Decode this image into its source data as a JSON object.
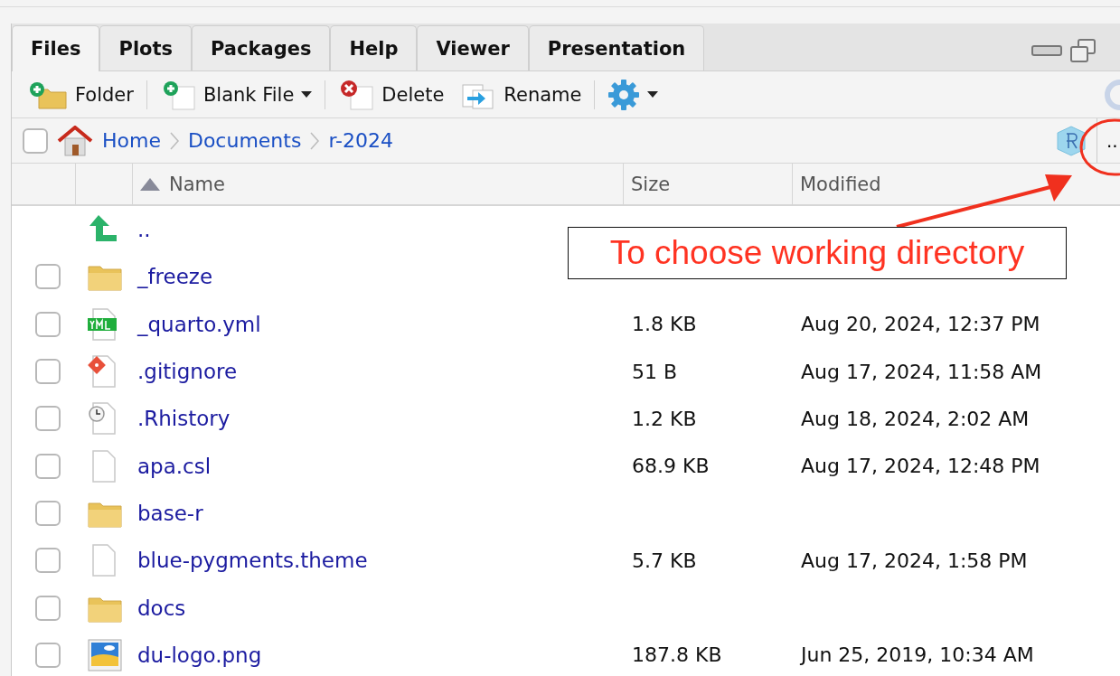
{
  "tabs": [
    {
      "label": "Files",
      "selected": true
    },
    {
      "label": "Plots",
      "selected": false
    },
    {
      "label": "Packages",
      "selected": false
    },
    {
      "label": "Help",
      "selected": false
    },
    {
      "label": "Viewer",
      "selected": false
    },
    {
      "label": "Presentation",
      "selected": false
    }
  ],
  "toolbar": [
    {
      "kind": "folder",
      "label": "Folder",
      "dropdown": false
    },
    {
      "kind": "file",
      "label": "Blank File",
      "dropdown": true
    },
    {
      "kind": "delete",
      "label": "Delete",
      "dropdown": false
    },
    {
      "kind": "rename",
      "label": "Rename",
      "dropdown": false
    },
    {
      "kind": "gear",
      "dropdown": true
    }
  ],
  "breadcrumb": {
    "select_all": {
      "checked": false
    },
    "path": [
      "Home",
      "Documents",
      "r-2024"
    ],
    "more_button": ".."
  },
  "columns": [
    {
      "label": "Name",
      "sorted": true
    },
    {
      "label": "Size",
      "sorted": false
    },
    {
      "label": "Modified",
      "sorted": false
    }
  ],
  "rows": [
    {
      "kind": "parent",
      "name": ".."
    },
    {
      "kind": "folder",
      "name": "_freeze",
      "checked": false
    },
    {
      "kind": "yml",
      "name": "_quarto.yml",
      "size": "1.8 KB",
      "modified": "Aug 20, 2024, 12:37 PM",
      "checked": false
    },
    {
      "kind": "git",
      "name": ".gitignore",
      "size": "51 B",
      "modified": "Aug 17, 2024, 11:58 AM",
      "checked": false
    },
    {
      "kind": "history",
      "name": ".Rhistory",
      "size": "1.2 KB",
      "modified": "Aug 18, 2024, 2:02 AM",
      "checked": false
    },
    {
      "kind": "file",
      "name": "apa.csl",
      "size": "68.9 KB",
      "modified": "Aug 17, 2024, 12:48 PM",
      "checked": false
    },
    {
      "kind": "folder",
      "name": "base-r",
      "checked": false
    },
    {
      "kind": "file",
      "name": "blue-pygments.theme",
      "size": "5.7 KB",
      "modified": "Aug 17, 2024, 1:58 PM",
      "checked": false
    },
    {
      "kind": "folder",
      "name": "docs",
      "checked": false
    },
    {
      "kind": "image",
      "name": "du-logo.png",
      "size": "187.8 KB",
      "modified": "Jun 25, 2019, 10:34 AM",
      "checked": false
    }
  ],
  "annotation": {
    "text": "To choose working directory"
  }
}
